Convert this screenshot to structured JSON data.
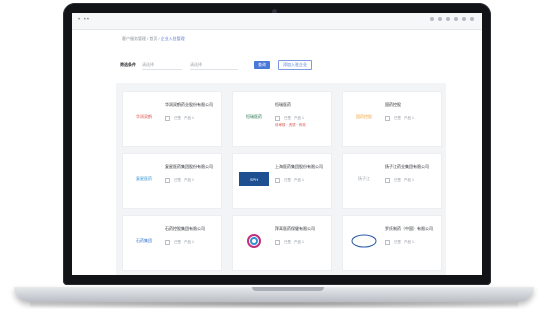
{
  "browser": {
    "left_text": "• ••",
    "right_dots": 6
  },
  "page": {
    "breadcrumb_prefix": "客户服务管理 / 首页 /",
    "breadcrumb_current": "企业入驻管理"
  },
  "filters": {
    "label": "筛选条件",
    "select1": "请选择",
    "select2": "请选择",
    "query_label": "查询",
    "secondary_label": "添加入驻企业"
  },
  "cards": [
    {
      "name": "华润双鹤药业股份有限公司",
      "logo": "华润双鹤",
      "logo_color": "#d9534f",
      "meta1": "已签",
      "meta2": "产品 1",
      "tag": ""
    },
    {
      "name": "恒瑞医药",
      "logo": "恒瑞医药",
      "logo_color": "#1f6f4a",
      "meta1": "已签",
      "meta2": "产品 1",
      "tag": "待审核 · 资质 · 有效"
    },
    {
      "name": "国药控股",
      "logo": "国药控股",
      "logo_color": "#f0a33b",
      "meta1": "已签",
      "meta2": "产品 1",
      "tag": ""
    },
    {
      "name": "复星医药集团股份有限公司",
      "logo": "复星医药",
      "logo_color": "#2f8fd0",
      "meta1": "已签",
      "meta2": "产品 1",
      "tag": ""
    },
    {
      "name": "上海医药集团股份有限公司",
      "logo": "SPH",
      "logo_color": "#1d4f91",
      "meta1": "已签",
      "meta2": "产品 1",
      "tag": ""
    },
    {
      "name": "扬子江药业集团有限公司",
      "logo": "扬子江",
      "logo_color": "#9aa0a8",
      "meta1": "已签",
      "meta2": "产品 1",
      "tag": ""
    },
    {
      "name": "石药控股集团有限公司",
      "logo": "石药集团",
      "logo_color": "#2a6fd0",
      "meta1": "已签",
      "meta2": "产品 1",
      "tag": ""
    },
    {
      "name": "拜耳医药保健有限公司",
      "logo": "Bayer",
      "logo_color": "#c0307f",
      "meta1": "已签",
      "meta2": "产品 1",
      "tag": ""
    },
    {
      "name": "罗氏制药（中国）有限公司",
      "logo": "Roche",
      "logo_color": "#2b5aa8",
      "meta1": "已签",
      "meta2": "产品 1",
      "tag": ""
    }
  ]
}
